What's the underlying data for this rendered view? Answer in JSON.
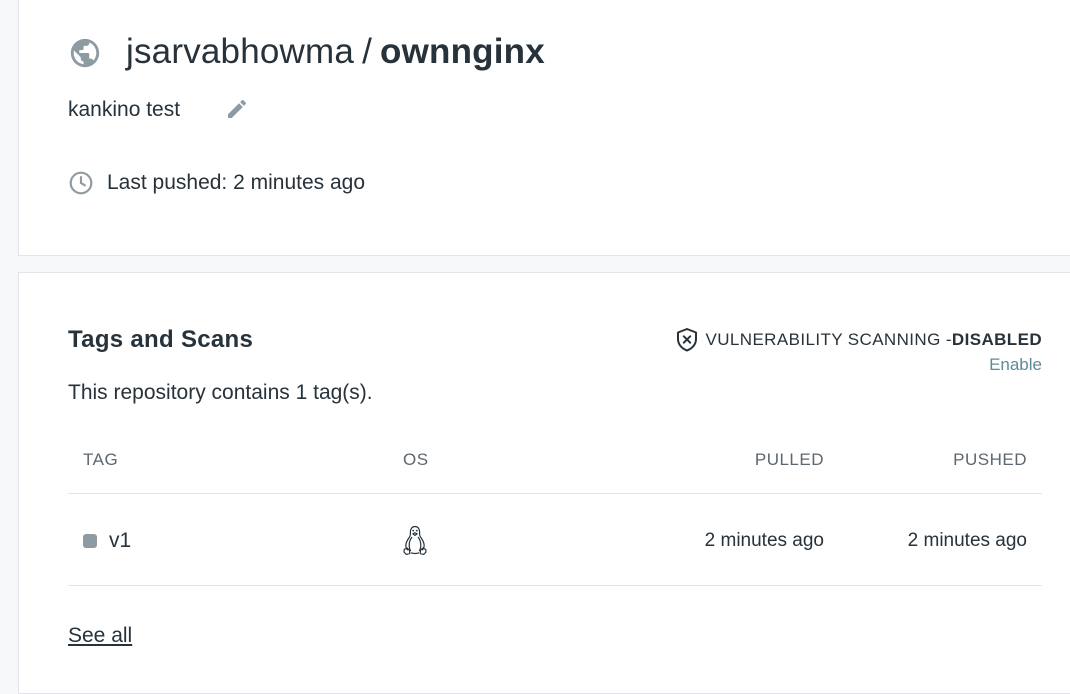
{
  "repo": {
    "owner": "jsarvabhowma",
    "separator": "/",
    "name": "ownnginx",
    "description": "kankino test",
    "last_pushed": "Last pushed: 2 minutes ago"
  },
  "tags_section": {
    "title": "Tags and Scans",
    "vuln_label": "VULNERABILITY SCANNING - ",
    "vuln_status": "DISABLED",
    "enable_label": "Enable",
    "tag_count_text": "This repository contains 1 tag(s).",
    "columns": {
      "tag": "TAG",
      "os": "OS",
      "pulled": "PULLED",
      "pushed": "PUSHED"
    },
    "rows": [
      {
        "tag": "v1",
        "os": "linux-icon",
        "pulled": "2 minutes ago",
        "pushed": "2 minutes ago"
      }
    ],
    "see_all_label": "See all"
  },
  "colors": {
    "accent_link": "#5f8a9a",
    "text": "#27323a",
    "muted": "#5c6770",
    "tag_dot": "#8f9ba3",
    "icon_gray": "#8f9ba3"
  },
  "icons": [
    "globe-icon",
    "edit-icon",
    "clock-icon",
    "shield-x-icon",
    "linux-icon"
  ]
}
